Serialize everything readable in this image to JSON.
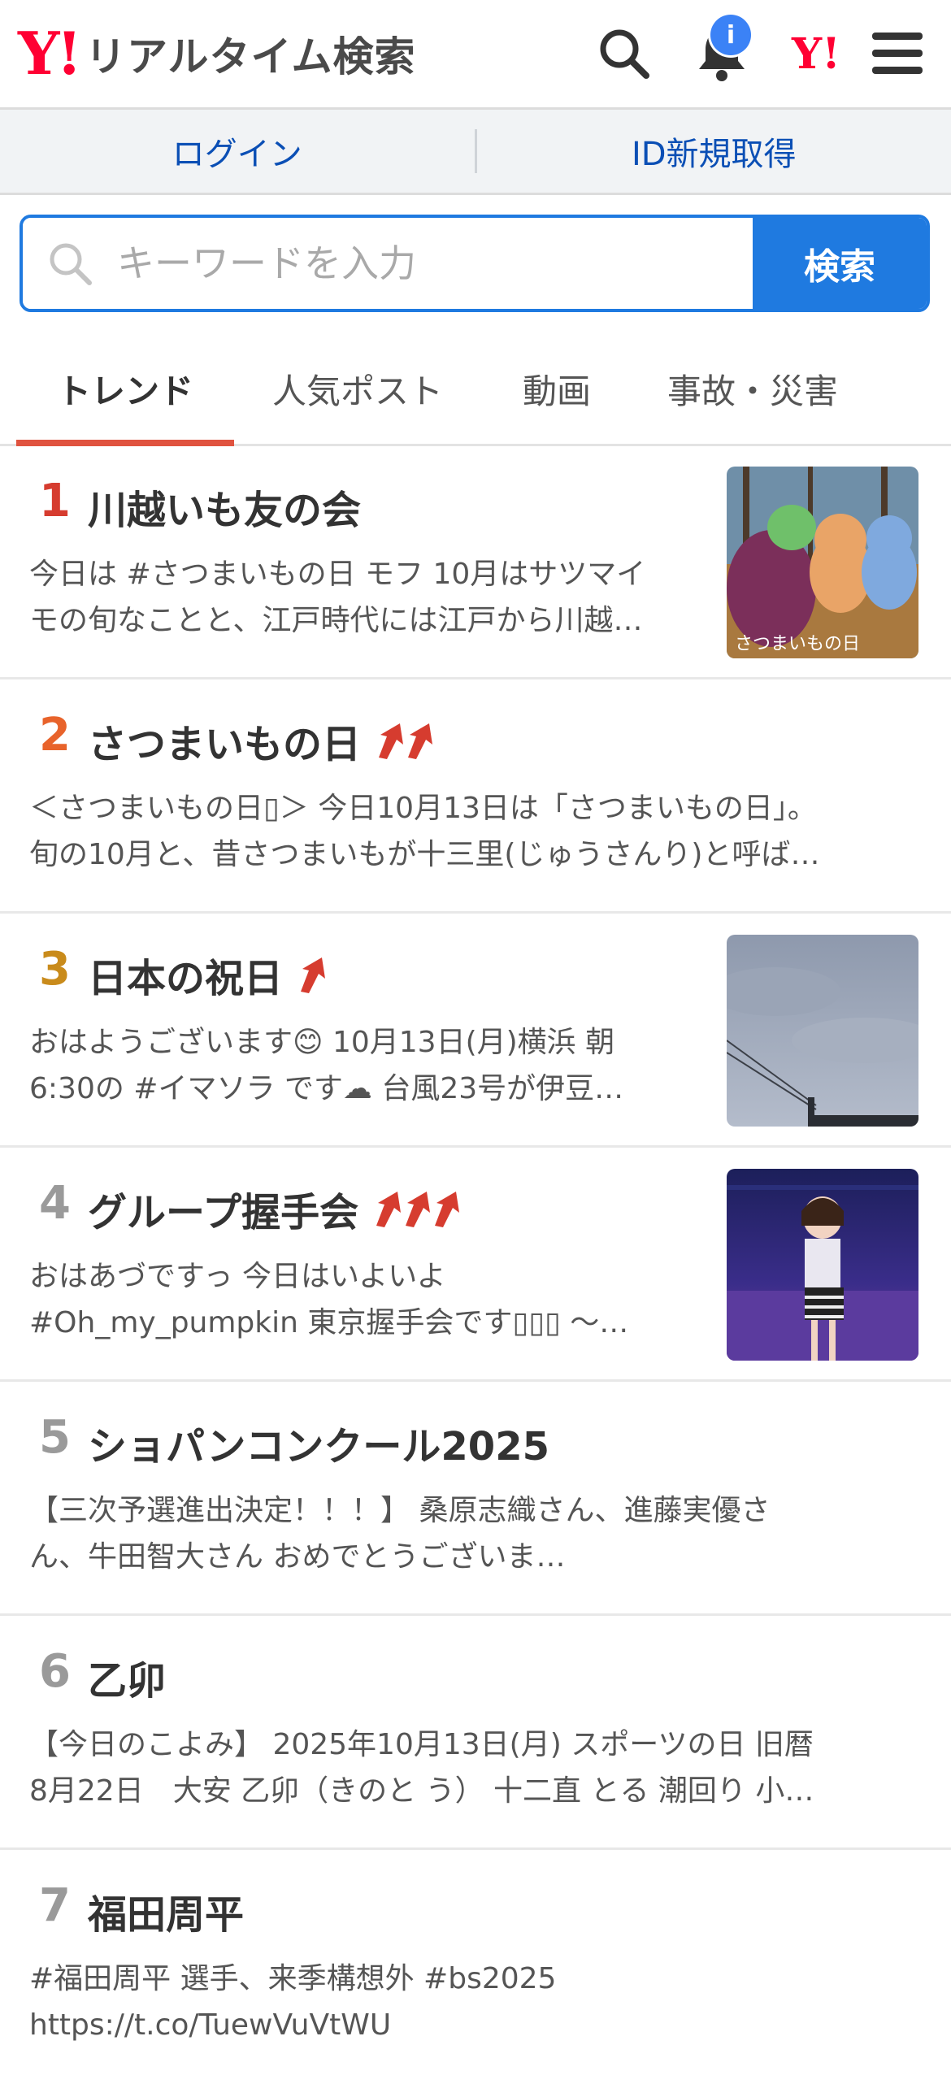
{
  "header": {
    "logo_mark": "Y!",
    "logo_text": "リアルタイム検索",
    "notification_badge": "i",
    "yahoo_mark": "Y!",
    "icons": [
      "search-icon",
      "bell-icon",
      "yahoo-logo-icon",
      "hamburger-menu-icon"
    ]
  },
  "loginbar": {
    "login": "ログイン",
    "register": "ID新規取得"
  },
  "search": {
    "placeholder": "キーワードを入力",
    "button": "検索"
  },
  "tabs": [
    {
      "label": "トレンド",
      "active": true
    },
    {
      "label": "人気ポスト",
      "active": false
    },
    {
      "label": "動画",
      "active": false
    },
    {
      "label": "事故・災害",
      "active": false
    }
  ],
  "colors": {
    "accent": "#1f7ae0",
    "rank1": "#d63c2f",
    "rank2": "#e8632b",
    "rank3": "#c98b1b",
    "rank_default": "#9a9a9a",
    "trend_arrow": "#d63c2f",
    "active_tab": "#e0533f"
  },
  "trends": [
    {
      "rank": "1",
      "title": "川越いも友の会",
      "arrows": 0,
      "desc1": "今日は #さつまいもの日 モフ 10月はサツマイ",
      "desc2": "モの旬なことと、江戸時代には江戸から川越…",
      "thumb": "illustration",
      "thumb_caption": "さつまいもの日"
    },
    {
      "rank": "2",
      "title": "さつまいもの日",
      "arrows": 2,
      "desc1": "＜さつまいもの日▯＞ 今日10月13日は「さつまいもの日」。",
      "desc2": "旬の10月と、昔さつまいもが十三里(じゅうさんり)と呼ば…",
      "thumb": ""
    },
    {
      "rank": "3",
      "title": "日本の祝日",
      "arrows": 1,
      "desc1": "おはようございます😊 10月13日(月)横浜 朝",
      "desc2": "6:30の #イマソラ です☁ 台風23号が伊豆…",
      "thumb": "sky"
    },
    {
      "rank": "4",
      "title": "グループ握手会",
      "arrows": 3,
      "desc1": "おはあづですっ 今日はいよいよ",
      "desc2": "#Oh_my_pumpkin 東京握手会です▯▯▯ 〜…",
      "thumb": "stage"
    },
    {
      "rank": "5",
      "title": "ショパンコンクール2025",
      "arrows": 0,
      "desc1": "【三次予選進出決定！！！】 桑原志織さん、進藤実優さ",
      "desc2": "ん、牛田智大さん おめでとうございま…",
      "thumb": ""
    },
    {
      "rank": "6",
      "title": "乙卯",
      "arrows": 0,
      "desc1": "【今日のこよみ】 2025年10月13日(月) スポーツの日 旧暦",
      "desc2": "8月22日　大安 乙卯（きのと う） 十二直 とる 潮回り 小…",
      "thumb": ""
    },
    {
      "rank": "7",
      "title": "福田周平",
      "arrows": 0,
      "desc1": "#福田周平 選手、来季構想外 #bs2025",
      "desc2": "https://t.co/TuewVuVtWU",
      "thumb": ""
    }
  ]
}
